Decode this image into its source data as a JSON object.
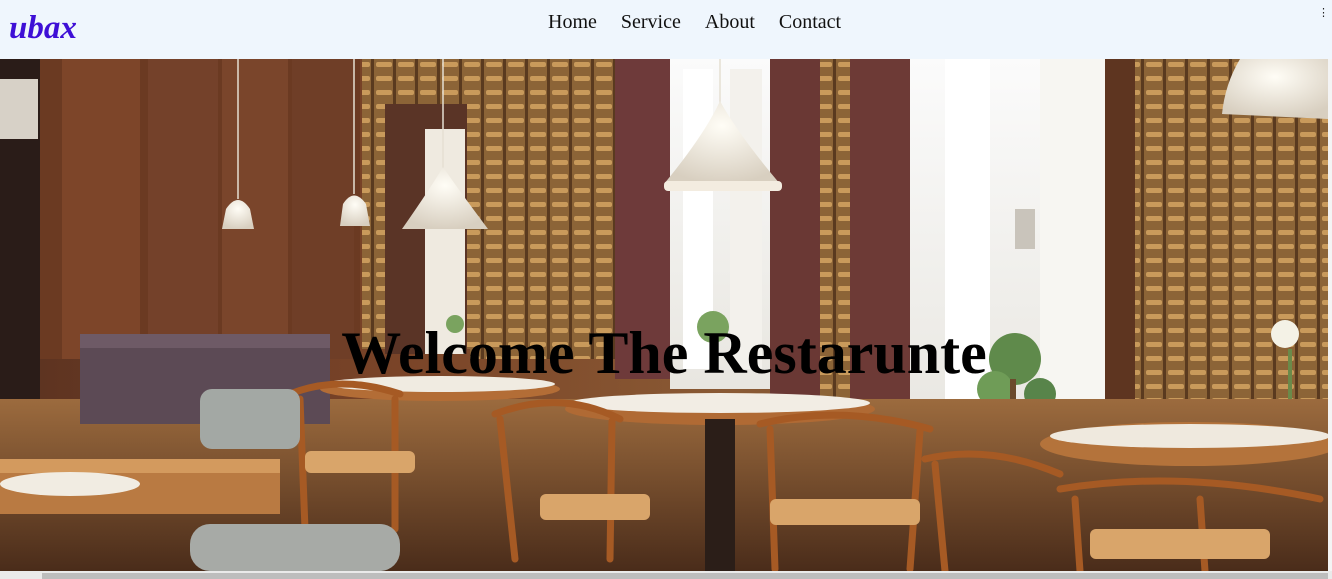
{
  "brand": {
    "logo_text": "ubax",
    "logo_color": "#3e0fd6"
  },
  "nav": {
    "items": [
      {
        "label": "Home"
      },
      {
        "label": "Service"
      },
      {
        "label": "About"
      },
      {
        "label": "Contact"
      }
    ]
  },
  "hero": {
    "title": "Welcome The Restarunte",
    "image_subject": "restaurant interior with wooden chairs, round tables and pendant lamps"
  },
  "colors": {
    "navbar_bg": "#eff6fd",
    "title_text": "#000000"
  }
}
